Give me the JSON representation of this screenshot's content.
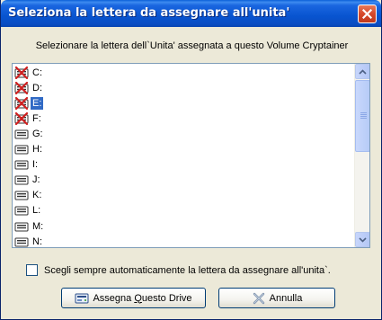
{
  "window": {
    "title": "Seleziona la lettera da assegnare all'unita'"
  },
  "prompt": "Selezionare la lettera dell`Unita' assegnata a questo Volume Cryptainer",
  "drives": [
    {
      "label": "C:",
      "status": "unavailable",
      "icon": "drive-unavailable-icon"
    },
    {
      "label": "D:",
      "status": "unavailable",
      "icon": "drive-unavailable-icon"
    },
    {
      "label": "E:",
      "status": "unavailable",
      "icon": "drive-unavailable-icon",
      "selected": true
    },
    {
      "label": "F:",
      "status": "unavailable",
      "icon": "drive-unavailable-icon"
    },
    {
      "label": "G:",
      "status": "available",
      "icon": "drive-icon"
    },
    {
      "label": "H:",
      "status": "available",
      "icon": "drive-icon"
    },
    {
      "label": "I:",
      "status": "available",
      "icon": "drive-icon"
    },
    {
      "label": "J:",
      "status": "available",
      "icon": "drive-icon"
    },
    {
      "label": "K:",
      "status": "available",
      "icon": "drive-icon"
    },
    {
      "label": "L:",
      "status": "available",
      "icon": "drive-icon"
    },
    {
      "label": "M:",
      "status": "available",
      "icon": "drive-icon"
    },
    {
      "label": "N:",
      "status": "available",
      "icon": "drive-icon"
    }
  ],
  "auto_assign": {
    "label": "Scegli sempre automaticamente la lettera da assegnare all'unita`.",
    "checked": false
  },
  "buttons": {
    "assign": {
      "label_pre": "Assegna ",
      "label_accel": "Q",
      "label_post": "uesto Drive",
      "icon": "drive-assign-icon"
    },
    "cancel": {
      "label": "Annulla",
      "icon": "cancel-x-icon"
    }
  },
  "colors": {
    "titlebar": "#0a54d0",
    "selection": "#316ac5",
    "unavailable_mark": "#d02020"
  }
}
